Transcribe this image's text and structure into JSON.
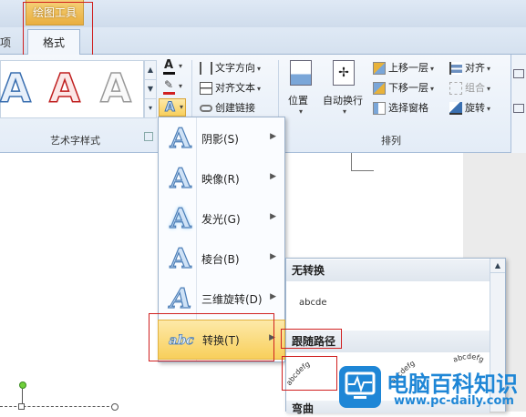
{
  "ribbon": {
    "contextual_tab": "绘图工具",
    "tab_prev_partial": "项",
    "tab_format": "格式",
    "art_text_group_label": "艺术字样式",
    "arrange_group_label": "排列",
    "sample_letter": "A",
    "text_direction": "文字方向",
    "align_text": "对齐文本",
    "create_link": "创建链接",
    "position": "位置",
    "auto_wrap": "自动换行",
    "bring_forward": "上移一层",
    "send_backward": "下移一层",
    "selection_pane": "选择窗格",
    "align": "对齐",
    "group": "组合",
    "rotate": "旋转"
  },
  "menu": {
    "items": [
      {
        "label": "阴影(S)"
      },
      {
        "label": "映像(R)"
      },
      {
        "label": "发光(G)"
      },
      {
        "label": "棱台(B)"
      },
      {
        "label": "三维旋转(D)"
      },
      {
        "label": "转换(T)"
      }
    ]
  },
  "submenu": {
    "no_transform_header": "无转换",
    "no_transform_sample": "abcde",
    "follow_path_header": "跟随路径",
    "path_sample": "abcdefg",
    "warp_header_partial": "弯曲"
  },
  "watermark": {
    "title": "电脑百科知识",
    "url": "www.pc-daily.com"
  },
  "colors": {
    "highlight_red": "#d02020",
    "menu_hover": "#f8cf5b",
    "watermark_blue": "#1e86d6"
  }
}
